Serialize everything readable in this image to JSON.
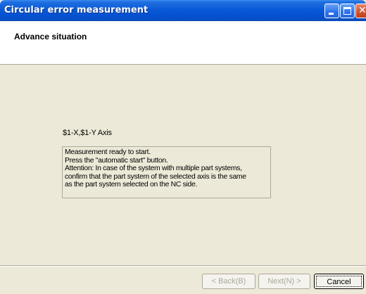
{
  "window": {
    "title": "Circular error measurement",
    "controls": [
      "minimize-icon",
      "maximize-icon",
      "close-icon"
    ],
    "colors": {
      "titlebar": "#0a5ad8",
      "background": "#ece9d8",
      "header": "#ffffff"
    }
  },
  "header": {
    "title": "Advance situation"
  },
  "main": {
    "axis_label": "$1-X,$1-Y Axis",
    "message_lines": [
      "Measurement ready to start.",
      "Press the \"automatic start\" button.",
      "Attention: In case of the system with multiple part systems,",
      "confirm that the part system of the selected axis is the same",
      "as the part system selected on the NC side."
    ]
  },
  "footer": {
    "back_label": "< Back(B)",
    "next_label": "Next(N) >",
    "cancel_label": "Cancel"
  }
}
